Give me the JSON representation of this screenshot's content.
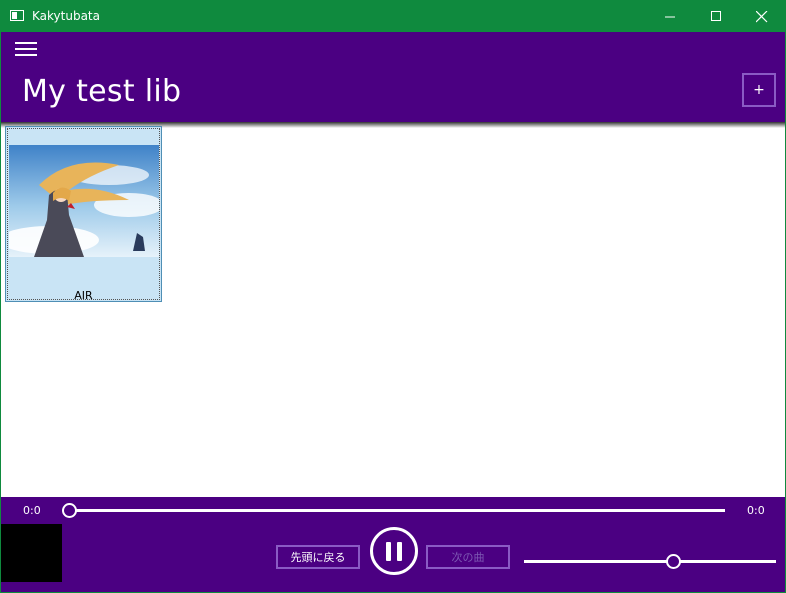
{
  "window": {
    "title": "Kakytubata",
    "controls": {
      "minimize": "—",
      "maximize": "☐",
      "close": "✕"
    }
  },
  "header": {
    "menu_icon": "hamburger-icon",
    "title": "My test lib",
    "add_label": "+"
  },
  "library": {
    "albums": [
      {
        "name": "AIR",
        "art_text": "AIR"
      }
    ]
  },
  "player": {
    "elapsed": "0:0",
    "duration": "0:0",
    "seek_fraction": 0,
    "volume_fraction": 0.58,
    "prev_label": "先頭に戻る",
    "next_label": "次の曲",
    "play_state": "pause-icon"
  },
  "colors": {
    "titlebar": "#0f8a3e",
    "accent": "#4b0082",
    "button_border": "#8a5bc4",
    "tile_bg": "#c9e4f5"
  }
}
